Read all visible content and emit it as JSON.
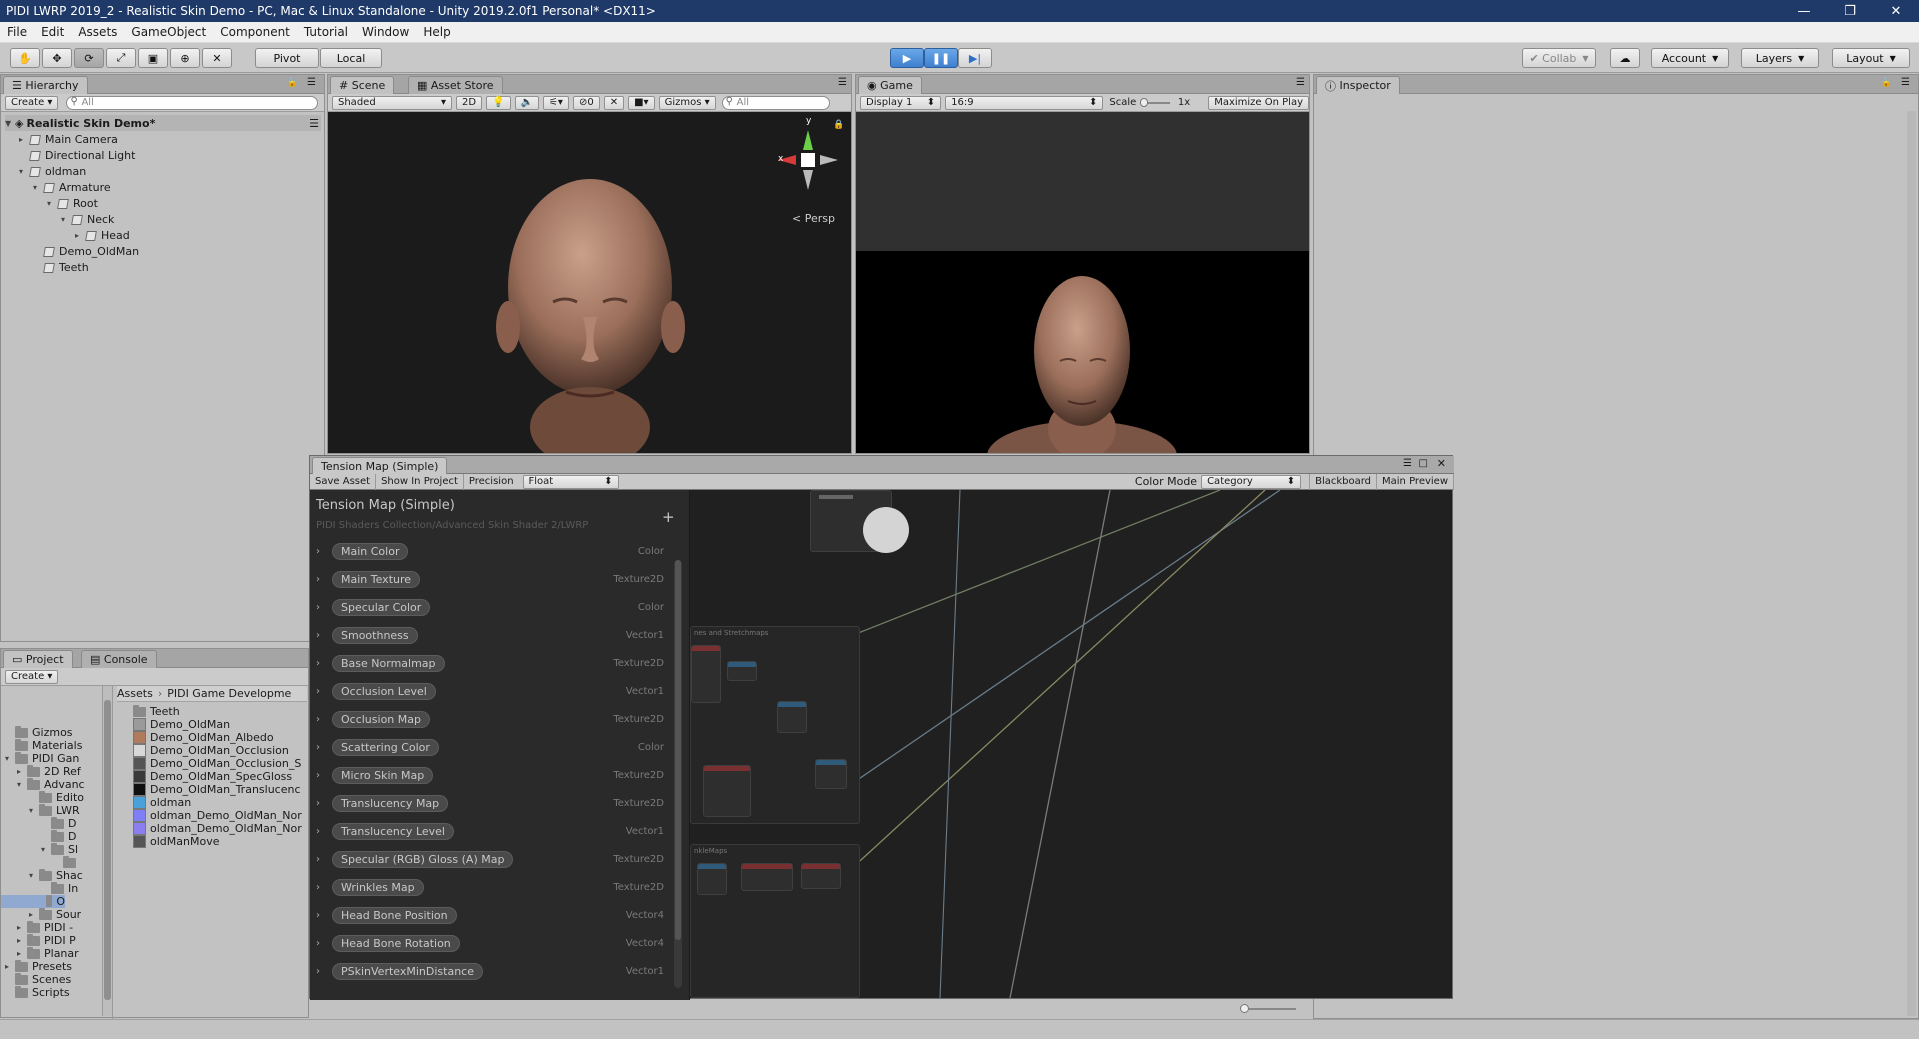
{
  "window": {
    "title": "PIDI LWRP 2019_2 - Realistic Skin Demo - PC, Mac & Linux Standalone - Unity 2019.2.0f1 Personal* <DX11>",
    "minimize": "—",
    "maximize": "❐",
    "close": "✕"
  },
  "menu": [
    "File",
    "Edit",
    "Assets",
    "GameObject",
    "Component",
    "Tutorial",
    "Window",
    "Help"
  ],
  "toolbar": {
    "pivot": "Pivot",
    "local": "Local",
    "collab": "Collab",
    "account": "Account",
    "layers": "Layers",
    "layout": "Layout"
  },
  "hierarchy": {
    "tab": "Hierarchy",
    "create": "Create",
    "search_placeholder": "All",
    "scene_name": "Realistic Skin Demo*",
    "items": [
      {
        "label": "Main Camera",
        "depth": 1,
        "expand": "▸"
      },
      {
        "label": "Directional Light",
        "depth": 1,
        "expand": ""
      },
      {
        "label": "oldman",
        "depth": 1,
        "expand": "▾"
      },
      {
        "label": "Armature",
        "depth": 2,
        "expand": "▾"
      },
      {
        "label": "Root",
        "depth": 3,
        "expand": "▾"
      },
      {
        "label": "Neck",
        "depth": 4,
        "expand": "▾"
      },
      {
        "label": "Head",
        "depth": 5,
        "expand": "▸"
      },
      {
        "label": "Demo_OldMan",
        "depth": 2,
        "expand": ""
      },
      {
        "label": "Teeth",
        "depth": 2,
        "expand": ""
      }
    ]
  },
  "scene": {
    "tab": "Scene",
    "tab2": "Asset Store",
    "shading": "Shaded",
    "mode_2d": "2D",
    "fx_count": "0",
    "gizmos": "Gizmos",
    "search_placeholder": "All",
    "persp": "Persp",
    "axis_x": "x",
    "axis_y": "y"
  },
  "game": {
    "tab": "Game",
    "display": "Display 1",
    "aspect": "16:9",
    "scale_label": "Scale",
    "scale_value": "1x",
    "maximize": "Maximize On Play"
  },
  "inspector": {
    "tab": "Inspector"
  },
  "project": {
    "tab": "Project",
    "tab2": "Console",
    "create": "Create",
    "breadcrumb": [
      "Assets",
      "PIDI Game Developme"
    ],
    "tree": [
      {
        "label": "Gizmos",
        "x": 0
      },
      {
        "label": "Materials",
        "x": 0
      },
      {
        "label": "PIDI Gan",
        "x": 0,
        "expand": "▾"
      },
      {
        "label": "2D Ref",
        "x": 1,
        "expand": "▸"
      },
      {
        "label": "Advanc",
        "x": 1,
        "expand": "▾"
      },
      {
        "label": "Edito",
        "x": 2
      },
      {
        "label": "LWR",
        "x": 2,
        "expand": "▾"
      },
      {
        "label": "D",
        "x": 3
      },
      {
        "label": "D",
        "x": 3
      },
      {
        "label": "Sl",
        "x": 3,
        "expand": "▾"
      },
      {
        "label": "",
        "x": 4
      },
      {
        "label": "Shac",
        "x": 2,
        "expand": "▾"
      },
      {
        "label": "In",
        "x": 3
      },
      {
        "label": "O",
        "x": 3
      },
      {
        "label": "Sour",
        "x": 2,
        "expand": "▸"
      },
      {
        "label": "PIDI -",
        "x": 1,
        "expand": "▸"
      },
      {
        "label": "PIDI P",
        "x": 1,
        "expand": "▸"
      },
      {
        "label": "Planar",
        "x": 1,
        "expand": "▸"
      },
      {
        "label": "Presets",
        "x": 0,
        "expand": "▸"
      },
      {
        "label": "Scenes",
        "x": 0
      },
      {
        "label": "Scripts",
        "x": 0
      }
    ],
    "assets": [
      {
        "label": "Teeth",
        "icon": "folder",
        "color": "#8a8a8a"
      },
      {
        "label": "Demo_OldMan",
        "icon": "material",
        "color": "#9a9a9a"
      },
      {
        "label": "Demo_OldMan_Albedo",
        "icon": "texture",
        "color": "#b07a5c"
      },
      {
        "label": "Demo_OldMan_Occlusion",
        "icon": "texture",
        "color": "#d8d8d8"
      },
      {
        "label": "Demo_OldMan_Occlusion_S",
        "icon": "texture",
        "color": "#555555"
      },
      {
        "label": "Demo_OldMan_SpecGloss",
        "icon": "texture",
        "color": "#3a3a3a"
      },
      {
        "label": "Demo_OldMan_Translucenc",
        "icon": "texture",
        "color": "#101010"
      },
      {
        "label": "oldman",
        "icon": "model",
        "color": "#4aa0d8"
      },
      {
        "label": "oldman_Demo_OldMan_Nor",
        "icon": "texture",
        "color": "#7f7ff5"
      },
      {
        "label": "oldman_Demo_OldMan_Nor",
        "icon": "texture",
        "color": "#8b7ff0"
      },
      {
        "label": "oldManMove",
        "icon": "anim",
        "color": "#555555"
      }
    ]
  },
  "shader_graph": {
    "tab": "Tension Map (Simple)",
    "save": "Save Asset",
    "show": "Show In Project",
    "precision_label": "Precision",
    "precision_value": "Float",
    "color_mode_label": "Color Mode",
    "color_mode_value": "Category",
    "blackboard": "Blackboard",
    "main_preview": "Main Preview",
    "bb_title": "Tension Map (Simple)",
    "bb_path": "PIDI Shaders Collection/Advanced Skin Shader 2/LWRP",
    "add": "+",
    "properties": [
      {
        "name": "Main Color",
        "type": "Color"
      },
      {
        "name": "Main Texture",
        "type": "Texture2D"
      },
      {
        "name": "Specular Color",
        "type": "Color"
      },
      {
        "name": "Smoothness",
        "type": "Vector1"
      },
      {
        "name": "Base Normalmap",
        "type": "Texture2D"
      },
      {
        "name": "Occlusion Level",
        "type": "Vector1"
      },
      {
        "name": "Occlusion Map",
        "type": "Texture2D"
      },
      {
        "name": "Scattering Color",
        "type": "Color"
      },
      {
        "name": "Micro Skin Map",
        "type": "Texture2D"
      },
      {
        "name": "Translucency Map",
        "type": "Texture2D"
      },
      {
        "name": "Translucency Level",
        "type": "Vector1"
      },
      {
        "name": "Specular (RGB) Gloss (A) Map",
        "type": "Texture2D"
      },
      {
        "name": "Wrinkles Map",
        "type": "Texture2D"
      },
      {
        "name": "Head Bone Position",
        "type": "Vector4"
      },
      {
        "name": "Head Bone Rotation",
        "type": "Vector4"
      },
      {
        "name": "PSkinVertexMinDistance",
        "type": "Vector1"
      }
    ],
    "group1_title": "nes and Stretchmaps",
    "group2_title": "nkleMaps"
  }
}
